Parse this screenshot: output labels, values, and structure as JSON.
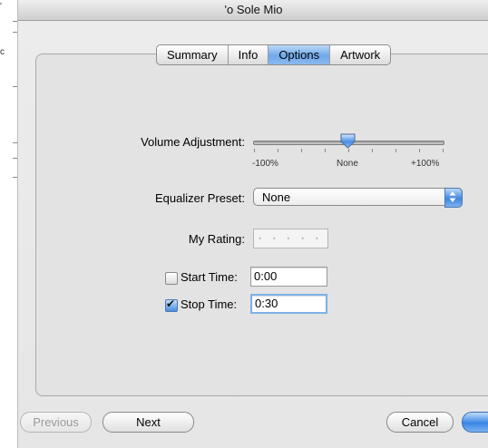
{
  "window": {
    "title": "'o Sole Mio"
  },
  "tabs": [
    {
      "label": "Summary",
      "selected": false
    },
    {
      "label": "Info",
      "selected": false
    },
    {
      "label": "Options",
      "selected": true
    },
    {
      "label": "Artwork",
      "selected": false
    }
  ],
  "volume": {
    "label": "Volume Adjustment:",
    "min_label": "-100%",
    "mid_label": "None",
    "max_label": "+100%",
    "value_percent": 0
  },
  "equalizer": {
    "label": "Equalizer Preset:",
    "value": "None"
  },
  "rating": {
    "label": "My Rating:",
    "stars": 0
  },
  "start_time": {
    "label": "Start Time:",
    "checked": false,
    "value": "0:00"
  },
  "stop_time": {
    "label": "Stop Time:",
    "checked": true,
    "value": "0:30"
  },
  "buttons": {
    "previous": "Previous",
    "next": "Next",
    "cancel": "Cancel",
    "ok": ""
  },
  "edge_marks": {
    "top": "'",
    "mid": "c"
  },
  "colors": {
    "accent": "#3a86e6",
    "selected_tab": "#6fa8ea"
  }
}
